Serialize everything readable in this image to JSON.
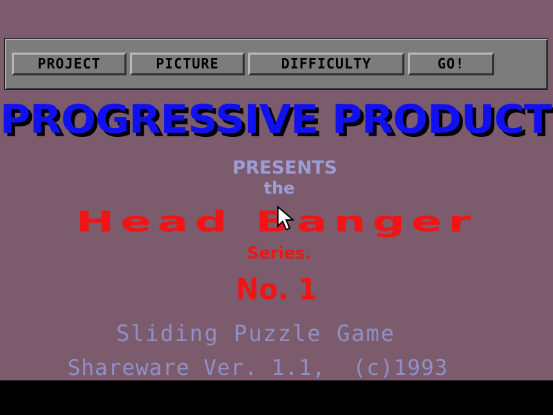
{
  "toolbar": {
    "buttons": [
      {
        "label": "PROJECT"
      },
      {
        "label": "PICTURE"
      },
      {
        "label": "DIFFICULTY"
      },
      {
        "label": "GO!"
      }
    ]
  },
  "title": {
    "company": "PROGRESSIVE PRODUCTS",
    "presents": "PRESENTS",
    "the": "the",
    "series_name": "Head Banger",
    "series_suffix": "Series.",
    "number": "No. 1"
  },
  "info": {
    "subtitle": "Sliding Puzzle Game",
    "version": "Shareware Ver. 1.1,  (c)1993"
  },
  "colors": {
    "background": "#7c5c6c",
    "toolbar": "#7c7c7c",
    "title_blue": "#1010f0",
    "accent_red": "#f01414",
    "text_lavender": "#9c9cd8"
  },
  "cursor": {
    "icon": "arrow-pointer-icon"
  }
}
